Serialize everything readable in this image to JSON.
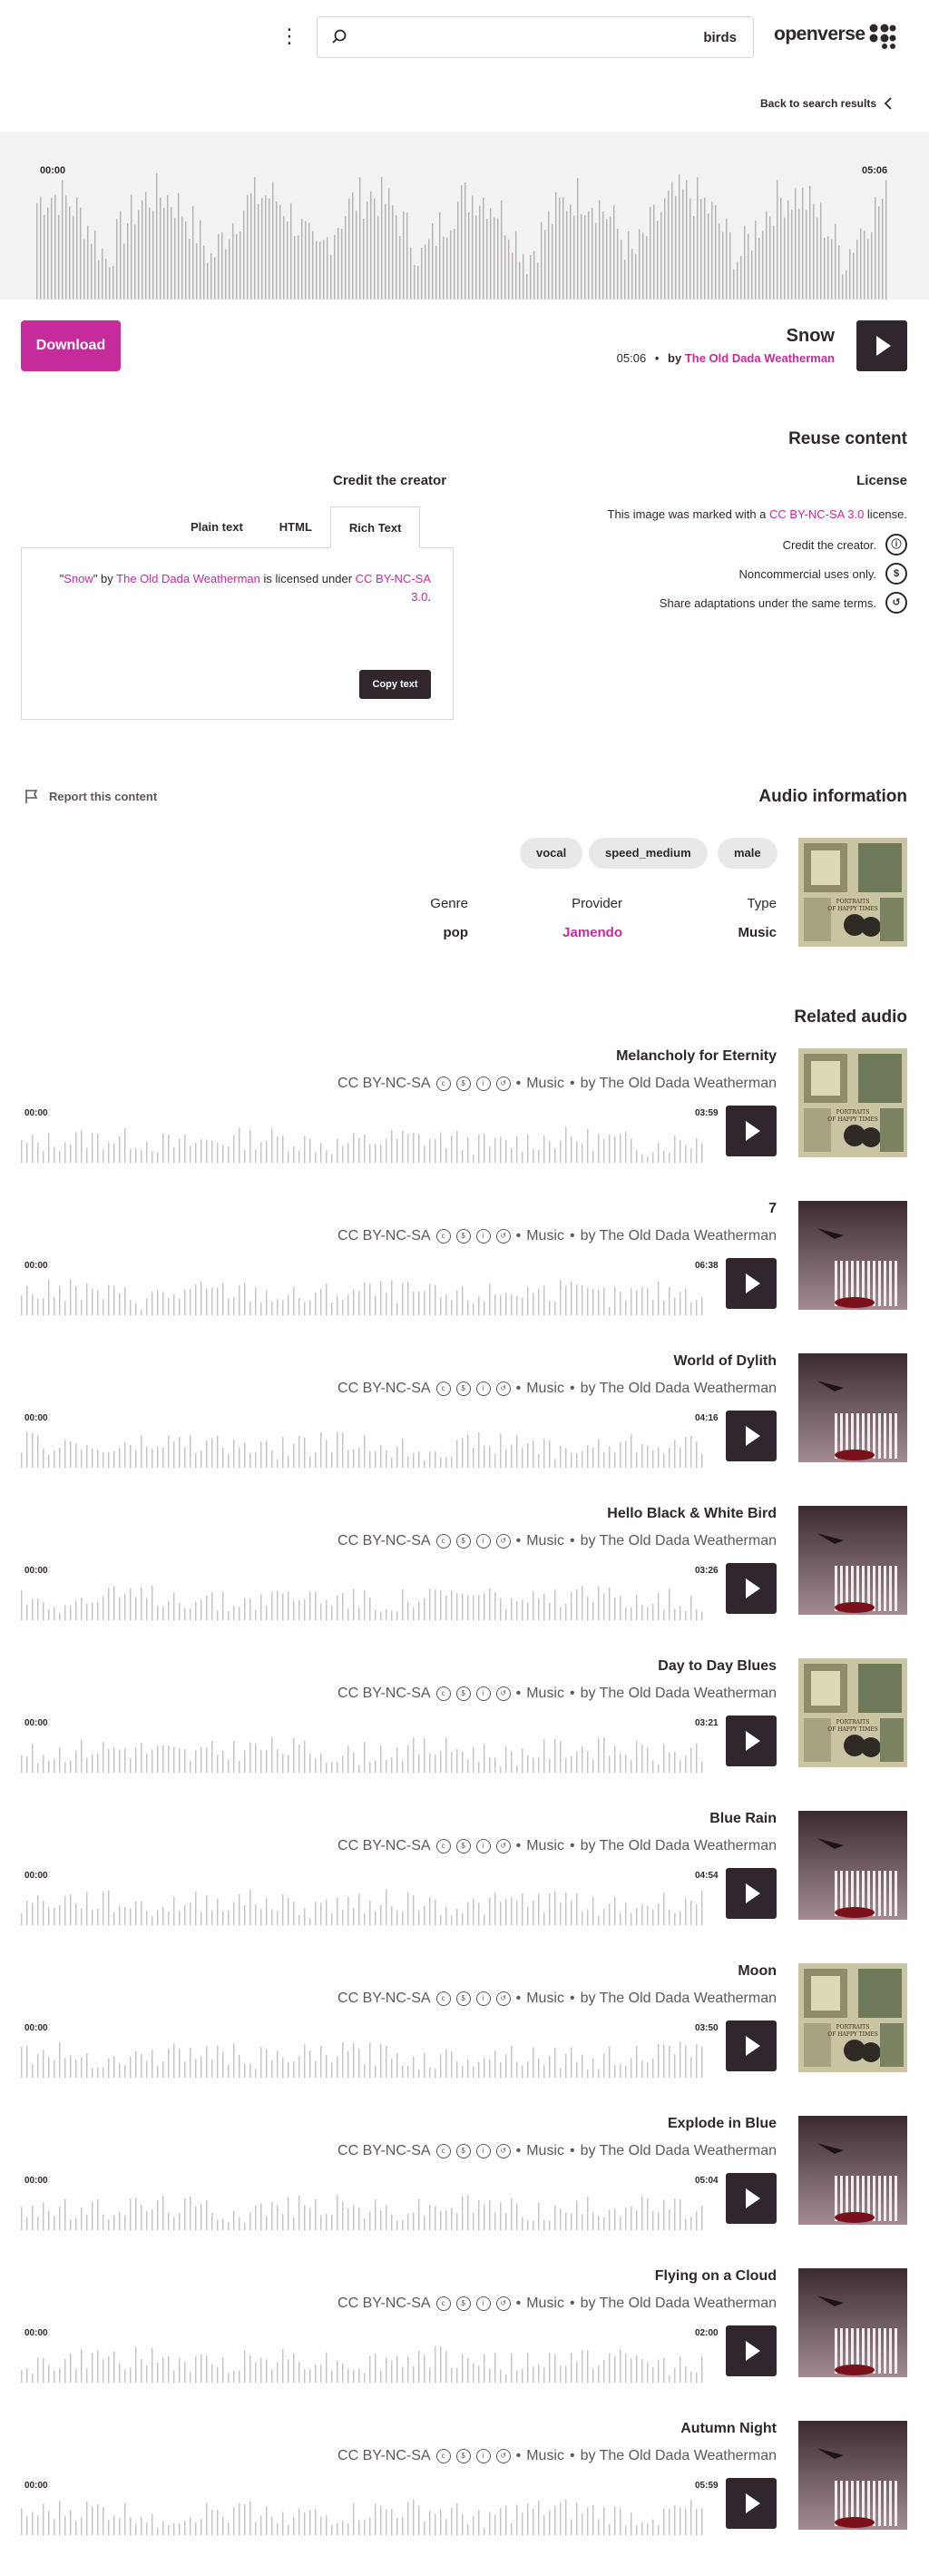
{
  "header": {
    "search_value": "birds",
    "brand": "openverse",
    "back_link": "Back to search results"
  },
  "audio": {
    "title": "Snow",
    "duration": "05:06",
    "by": "by",
    "artist": "The Old Dada Weatherman",
    "time_start": "00:00",
    "time_end": "05:06",
    "download_label": "Download"
  },
  "reuse": {
    "heading": "Reuse content",
    "credit_heading": "Credit the creator",
    "tabs": [
      "Plain text",
      "HTML",
      "Rich Text"
    ],
    "credit_q1": "\"",
    "credit_title": "Snow",
    "credit_mid1": "\" by ",
    "credit_artist": "The Old Dada Weatherman",
    "credit_mid2": " is licensed under ",
    "credit_license": "CC BY-NC-SA 3.0",
    "credit_end": ".",
    "copy_label": "Copy text",
    "license_heading": "License",
    "license_intro": "This image was marked with a",
    "license_link": "CC BY-NC-SA 3.0",
    "license_suffix": "license.",
    "terms": [
      "Credit the creator.",
      "Noncommercial uses only.",
      "Share adaptations under the same terms."
    ]
  },
  "info": {
    "report": "Report this content",
    "heading": "Audio information",
    "tags": [
      "vocal",
      "speed_medium",
      "male"
    ],
    "genre_label": "Genre",
    "genre": "pop",
    "provider_label": "Provider",
    "provider": "Jamendo",
    "type_label": "Type",
    "type": "Music"
  },
  "related": {
    "heading": "Related audio",
    "license": "CC BY-NC-SA",
    "category": "Music",
    "by_artist": "by The Old Dada Weatherman",
    "time_start": "00:00",
    "items": [
      {
        "title": "Melancholy for Eternity",
        "duration": "03:59",
        "cover": "portraits"
      },
      {
        "title": "7",
        "duration": "06:38",
        "cover": "dark"
      },
      {
        "title": "World of Dylith",
        "duration": "04:16",
        "cover": "dark"
      },
      {
        "title": "Hello Black & White Bird",
        "duration": "03:26",
        "cover": "dark"
      },
      {
        "title": "Day to Day Blues",
        "duration": "03:21",
        "cover": "portraits"
      },
      {
        "title": "Blue Rain",
        "duration": "04:54",
        "cover": "dark"
      },
      {
        "title": "Moon",
        "duration": "03:50",
        "cover": "portraits"
      },
      {
        "title": "Explode in Blue",
        "duration": "05:04",
        "cover": "dark"
      },
      {
        "title": "Flying on a Cloud",
        "duration": "02:00",
        "cover": "dark"
      },
      {
        "title": "Autumn Night",
        "duration": "05:59",
        "cover": "dark"
      }
    ]
  },
  "colors": {
    "accent": "#c52b9b",
    "dark": "#30272e",
    "wave_bg": "#f3f2f2",
    "bar": "#c8c4c6"
  },
  "cover_text": "PORTRAITS OF HAPPY TIMES"
}
